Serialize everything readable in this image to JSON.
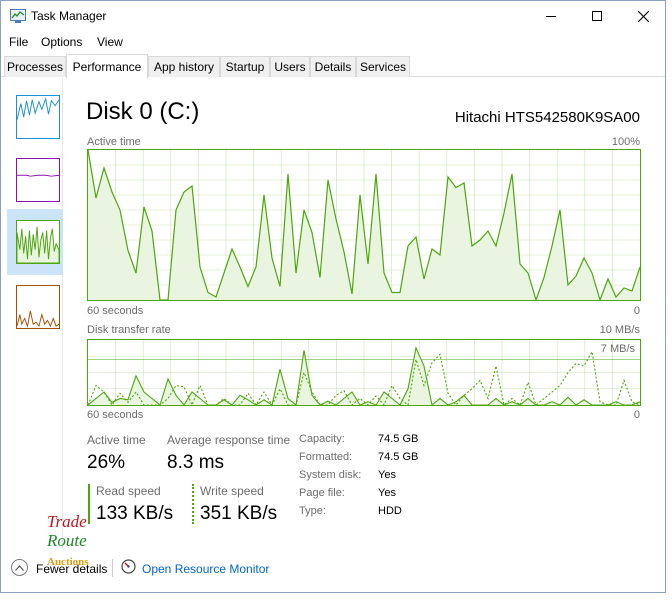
{
  "window": {
    "title": "Task Manager"
  },
  "colors": {
    "accent": "#4da60c",
    "fill": "#eaf5e1",
    "grid": "#c9e4b4",
    "link": "#0066cc",
    "selected": "#cce4f7"
  },
  "menu": {
    "file": "File",
    "options": "Options",
    "view": "View"
  },
  "tabs": [
    {
      "label": "Processes",
      "active": false
    },
    {
      "label": "Performance",
      "active": true
    },
    {
      "label": "App history",
      "active": false
    },
    {
      "label": "Startup",
      "active": false
    },
    {
      "label": "Users",
      "active": false
    },
    {
      "label": "Details",
      "active": false
    },
    {
      "label": "Services",
      "active": false
    }
  ],
  "sidebar": {
    "items": [
      {
        "icon": "cpu-graph-thumbnail",
        "color": "#1b8fd8"
      },
      {
        "icon": "memory-graph-thumbnail",
        "color": "#8b12ae"
      },
      {
        "icon": "disk-graph-thumbnail",
        "color": "#4da60c",
        "selected": true
      },
      {
        "icon": "ethernet-graph-thumbnail",
        "color": "#a74f01"
      }
    ]
  },
  "header": {
    "title": "Disk 0 (C:)",
    "model": "Hitachi HTS542580K9SA00"
  },
  "active_graph": {
    "label": "Active time",
    "max": "100%",
    "time_label": "60 seconds",
    "min": "0",
    "values": [
      100,
      68,
      88,
      72,
      60,
      33,
      18,
      62,
      46,
      0,
      0,
      60,
      72,
      76,
      22,
      5,
      2,
      18,
      34,
      22,
      9,
      22,
      70,
      28,
      9,
      84,
      18,
      60,
      45,
      15,
      80,
      54,
      32,
      4,
      70,
      24,
      84,
      18,
      5,
      5,
      36,
      42,
      14,
      34,
      30,
      82,
      75,
      78,
      36,
      40,
      46,
      36,
      58,
      84,
      24,
      18,
      0,
      15,
      36,
      60,
      10,
      16,
      28,
      18,
      0,
      14,
      2,
      8,
      6,
      22
    ]
  },
  "transfer_graph": {
    "label": "Disk transfer rate",
    "max": "10 MB/s",
    "scale_label": "7 MB/s",
    "time_label": "60 seconds",
    "min": "0",
    "read": [
      0,
      10,
      20,
      4,
      10,
      8,
      45,
      20,
      10,
      0,
      40,
      15,
      0,
      20,
      10,
      0,
      0,
      8,
      0,
      15,
      8,
      0,
      8,
      0,
      55,
      10,
      0,
      84,
      15,
      0,
      6,
      0,
      10,
      20,
      0,
      5,
      0,
      20,
      10,
      0,
      25,
      88,
      60,
      0,
      10,
      0,
      5,
      15,
      0,
      0,
      0,
      10,
      0,
      5,
      0,
      10,
      0,
      0,
      5,
      0,
      12,
      0,
      8,
      0,
      0,
      0,
      5,
      0,
      0,
      5
    ],
    "write": [
      0,
      30,
      20,
      0,
      18,
      4,
      20,
      0,
      0,
      0,
      10,
      30,
      28,
      0,
      30,
      0,
      0,
      10,
      0,
      0,
      18,
      0,
      20,
      0,
      25,
      0,
      0,
      50,
      20,
      0,
      0,
      15,
      22,
      0,
      10,
      0,
      14,
      0,
      30,
      10,
      0,
      70,
      30,
      65,
      78,
      18,
      0,
      15,
      25,
      38,
      10,
      60,
      0,
      10,
      0,
      35,
      0,
      10,
      20,
      30,
      50,
      64,
      60,
      82,
      5,
      0,
      0,
      38,
      5,
      0
    ]
  },
  "stats": {
    "active_time_label": "Active time",
    "active_time_value": "26%",
    "response_label": "Average response time",
    "response_value": "8.3 ms",
    "read_label": "Read speed",
    "read_value": "133 KB/s",
    "write_label": "Write speed",
    "write_value": "351 KB/s"
  },
  "info": [
    {
      "label": "Capacity:",
      "value": "74.5 GB"
    },
    {
      "label": "Formatted:",
      "value": "74.5 GB"
    },
    {
      "label": "System disk:",
      "value": "Yes"
    },
    {
      "label": "Page file:",
      "value": "Yes"
    },
    {
      "label": "Type:",
      "value": "HDD"
    }
  ],
  "footer": {
    "fewer_details": "Fewer details",
    "resource_monitor": "Open Resource Monitor"
  },
  "watermark": {
    "line1": "Trade",
    "line2": "Route",
    "line3": "Auctions"
  }
}
